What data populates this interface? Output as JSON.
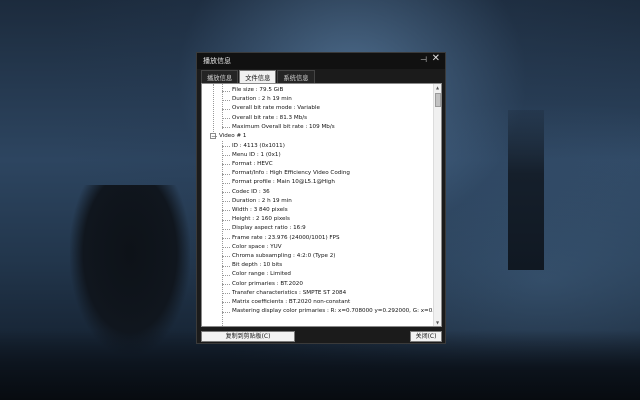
{
  "window": {
    "title": "播放信息",
    "pin_glyph": "⊣",
    "close_glyph": "✕"
  },
  "tabs": [
    {
      "label": "播放信息",
      "active": false
    },
    {
      "label": "文件信息",
      "active": true
    },
    {
      "label": "系统信息",
      "active": false
    }
  ],
  "tree": {
    "general_items": [
      "File size : 79.5 GiB",
      "Duration : 2 h 19 min",
      "Overall bit rate mode : Variable",
      "Overall bit rate : 81.3 Mb/s",
      "Maximum Overall bit rate : 109 Mb/s"
    ],
    "video_header": "Video # 1",
    "collapse_glyph": "−",
    "video_items": [
      "ID : 4113 (0x1011)",
      "Menu ID : 1 (0x1)",
      "Format : HEVC",
      "Format/Info : High Efficiency Video Coding",
      "Format profile : Main 10@L5.1@High",
      "Codec ID : 36",
      "Duration : 2 h 19 min",
      "Width : 3 840 pixels",
      "Height : 2 160 pixels",
      "Display aspect ratio : 16:9",
      "Frame rate : 23.976 (24000/1001) FPS",
      "Color space : YUV",
      "Chroma subsampling : 4:2:0 (Type 2)",
      "Bit depth : 10 bits",
      "Color range : Limited",
      "Color primaries : BT.2020",
      "Transfer characteristics : SMPTE ST 2084",
      "Matrix coefficients : BT.2020 non-constant",
      "Mastering display color primaries : R: x=0.708000 y=0.292000, G: x=0.170000 y"
    ]
  },
  "scrollbar": {
    "up_glyph": "▲",
    "down_glyph": "▼"
  },
  "buttons": {
    "copy": "复制到剪贴板(C)",
    "close": "关闭(C)"
  }
}
